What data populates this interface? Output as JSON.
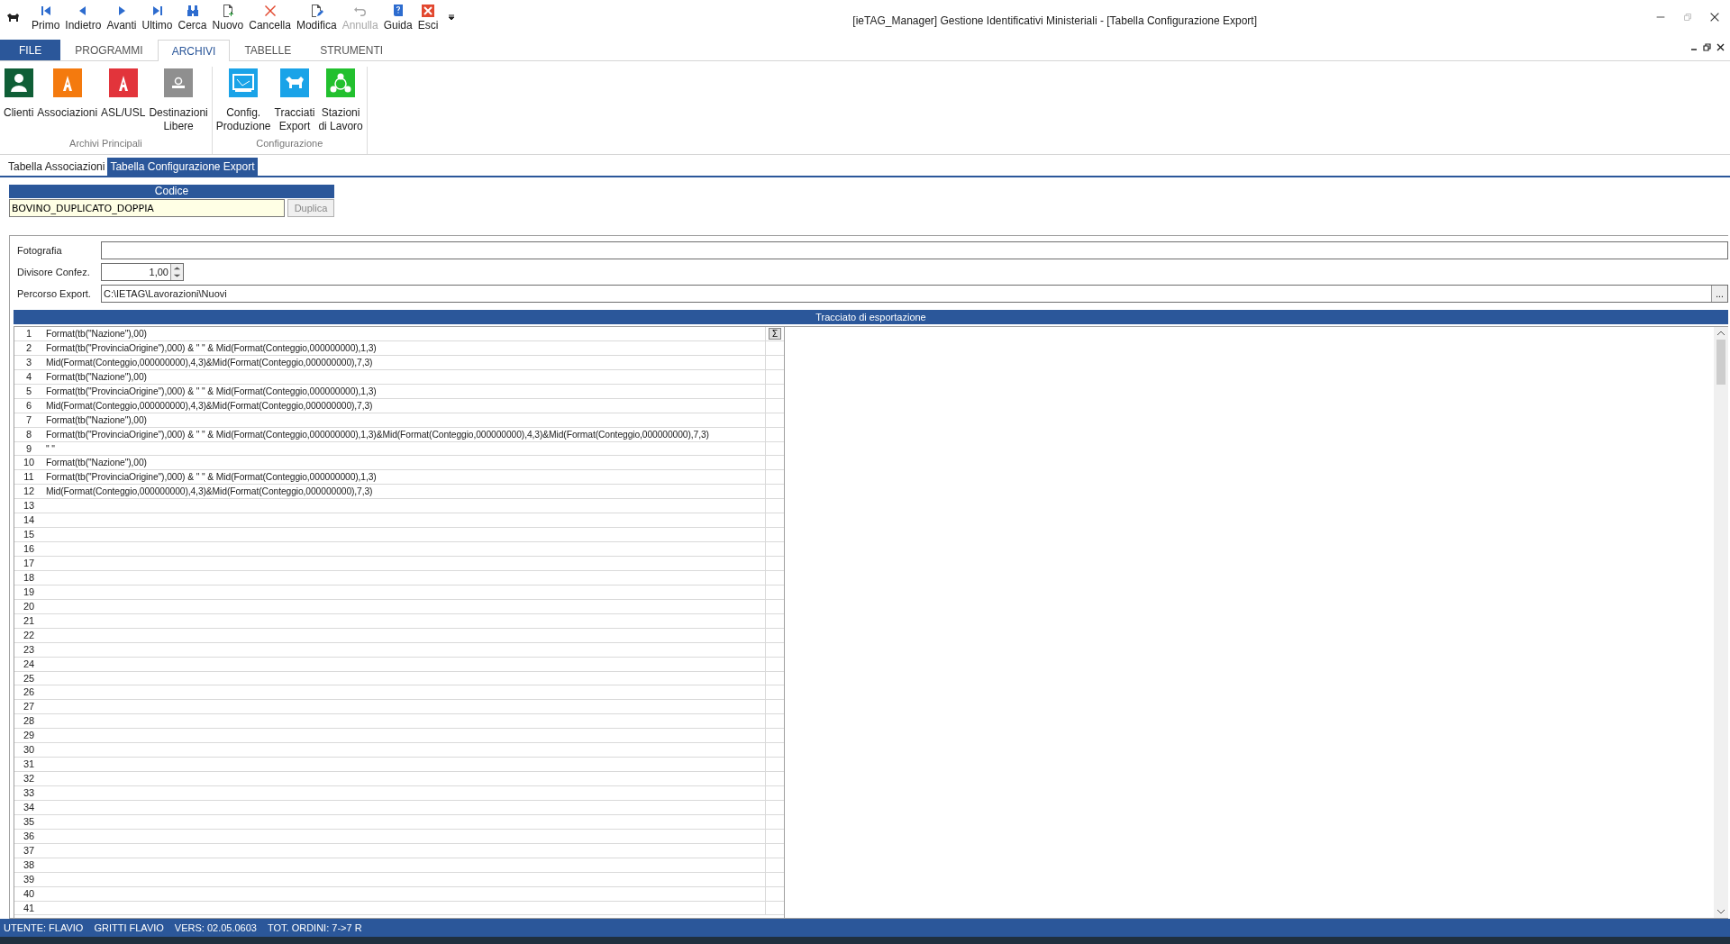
{
  "toolbar": {
    "buttons": [
      {
        "label": "Primo",
        "kind": "first",
        "disabled": false
      },
      {
        "label": "Indietro",
        "kind": "prev",
        "disabled": false
      },
      {
        "label": "Avanti",
        "kind": "next",
        "disabled": false
      },
      {
        "label": "Ultimo",
        "kind": "last",
        "disabled": false
      },
      {
        "label": "Cerca",
        "kind": "search",
        "disabled": false
      },
      {
        "label": "Nuovo",
        "kind": "new",
        "disabled": false
      },
      {
        "label": "Cancella",
        "kind": "delete",
        "disabled": false
      },
      {
        "label": "Modifica",
        "kind": "edit",
        "disabled": false
      },
      {
        "label": "Annulla",
        "kind": "undo",
        "disabled": true
      },
      {
        "label": "Guida",
        "kind": "help",
        "disabled": false
      },
      {
        "label": "Esci",
        "kind": "exit",
        "disabled": false
      }
    ]
  },
  "window": {
    "title": "[ieTAG_Manager] Gestione Identificativi Ministeriali - [Tabella Configurazione Export]"
  },
  "menu_tabs": [
    {
      "label": "FILE",
      "kind": "file",
      "selected": false
    },
    {
      "label": "PROGRAMMI",
      "kind": "tab",
      "selected": false
    },
    {
      "label": "ARCHIVI",
      "kind": "tab",
      "selected": true
    },
    {
      "label": "TABELLE",
      "kind": "tab",
      "selected": false
    },
    {
      "label": "STRUMENTI",
      "kind": "tab",
      "selected": false
    }
  ],
  "ribbon": {
    "groups": [
      {
        "label": "Archivi Principali",
        "items": [
          {
            "label": "Clienti",
            "kind": "person",
            "color": "#0f5e36"
          },
          {
            "label": "Associazioni",
            "kind": "letter",
            "color": "#f47a0e"
          },
          {
            "label": "ASL/USL",
            "kind": "letter",
            "color": "#e2343b"
          },
          {
            "label": "Destinazioni\nLibere",
            "kind": "pin",
            "color": "#8f8f8f"
          }
        ]
      },
      {
        "label": "Configurazione",
        "items": [
          {
            "label": "Config.\nProduzione",
            "kind": "screen",
            "color": "#1aa3e8"
          },
          {
            "label": "Tracciati\nExport",
            "kind": "cow",
            "color": "#1aa3e8"
          },
          {
            "label": "Stazioni\ndi Lavoro",
            "kind": "network",
            "color": "#22c02e"
          }
        ]
      }
    ]
  },
  "document_tabs": [
    {
      "label": "Tabella Associazioni",
      "selected": false
    },
    {
      "label": "Tabella Configurazione Export",
      "selected": true
    }
  ],
  "codice": {
    "header": "Codice",
    "value": "BOVINO_DUPLICATO_DOPPIA",
    "button": "Duplica",
    "button_disabled": true
  },
  "fields": [
    {
      "label": "Fotografia",
      "kind": "text"
    },
    {
      "label": "Divisore Confez.",
      "kind": "spin",
      "value": "1,00"
    },
    {
      "label": "Percorso Export.",
      "kind": "browse",
      "value": "C:\\IETAG\\Lavorazioni\\Nuovi",
      "button": "..."
    }
  ],
  "export_grid": {
    "title": "Tracciato di esportazione",
    "sum_button": "Σ",
    "rows": [
      {
        "number": "1",
        "expression": "Format(tb(\"Nazione\"),00)"
      },
      {
        "number": "2",
        "expression": "Format(tb(\"ProvinciaOrigine\"),000) & \" \" & Mid(Format(Conteggio,000000000),1,3)"
      },
      {
        "number": "3",
        "expression": "Mid(Format(Conteggio,000000000),4,3)&Mid(Format(Conteggio,000000000),7,3)"
      },
      {
        "number": "4",
        "expression": "Format(tb(\"Nazione\"),00)"
      },
      {
        "number": "5",
        "expression": "Format(tb(\"ProvinciaOrigine\"),000) & \" \" & Mid(Format(Conteggio,000000000),1,3)"
      },
      {
        "number": "6",
        "expression": "Mid(Format(Conteggio,000000000),4,3)&Mid(Format(Conteggio,000000000),7,3)"
      },
      {
        "number": "7",
        "expression": "Format(tb(\"Nazione\"),00)"
      },
      {
        "number": "8",
        "expression": "Format(tb(\"ProvinciaOrigine\"),000) & \" \" & Mid(Format(Conteggio,000000000),1,3)&Mid(Format(Conteggio,000000000),4,3)&Mid(Format(Conteggio,000000000),7,3)"
      },
      {
        "number": "9",
        "expression": "\" \""
      },
      {
        "number": "10",
        "expression": "Format(tb(\"Nazione\"),00)"
      },
      {
        "number": "11",
        "expression": "Format(tb(\"ProvinciaOrigine\"),000) & \" \" & Mid(Format(Conteggio,000000000),1,3)"
      },
      {
        "number": "12",
        "expression": "Mid(Format(Conteggio,000000000),4,3)&Mid(Format(Conteggio,000000000),7,3)"
      },
      {
        "number": "13"
      },
      {
        "number": "14"
      },
      {
        "number": "15"
      },
      {
        "number": "16"
      },
      {
        "number": "17"
      },
      {
        "number": "18"
      },
      {
        "number": "19"
      },
      {
        "number": "20"
      },
      {
        "number": "21"
      },
      {
        "number": "22"
      },
      {
        "number": "23"
      },
      {
        "number": "24"
      },
      {
        "number": "25"
      },
      {
        "number": "26"
      },
      {
        "number": "27"
      },
      {
        "number": "28"
      },
      {
        "number": "29"
      },
      {
        "number": "30"
      },
      {
        "number": "31"
      },
      {
        "number": "32"
      },
      {
        "number": "33"
      },
      {
        "number": "34"
      },
      {
        "number": "35"
      },
      {
        "number": "36"
      },
      {
        "number": "37"
      },
      {
        "number": "38"
      },
      {
        "number": "39"
      },
      {
        "number": "40"
      },
      {
        "number": "41"
      }
    ]
  },
  "status_bar": {
    "items": [
      "UTENTE: FLAVIO",
      "GRITTI FLAVIO",
      "VERS: 02.05.0603",
      "TOT. ORDINI: 7->7 R"
    ]
  }
}
